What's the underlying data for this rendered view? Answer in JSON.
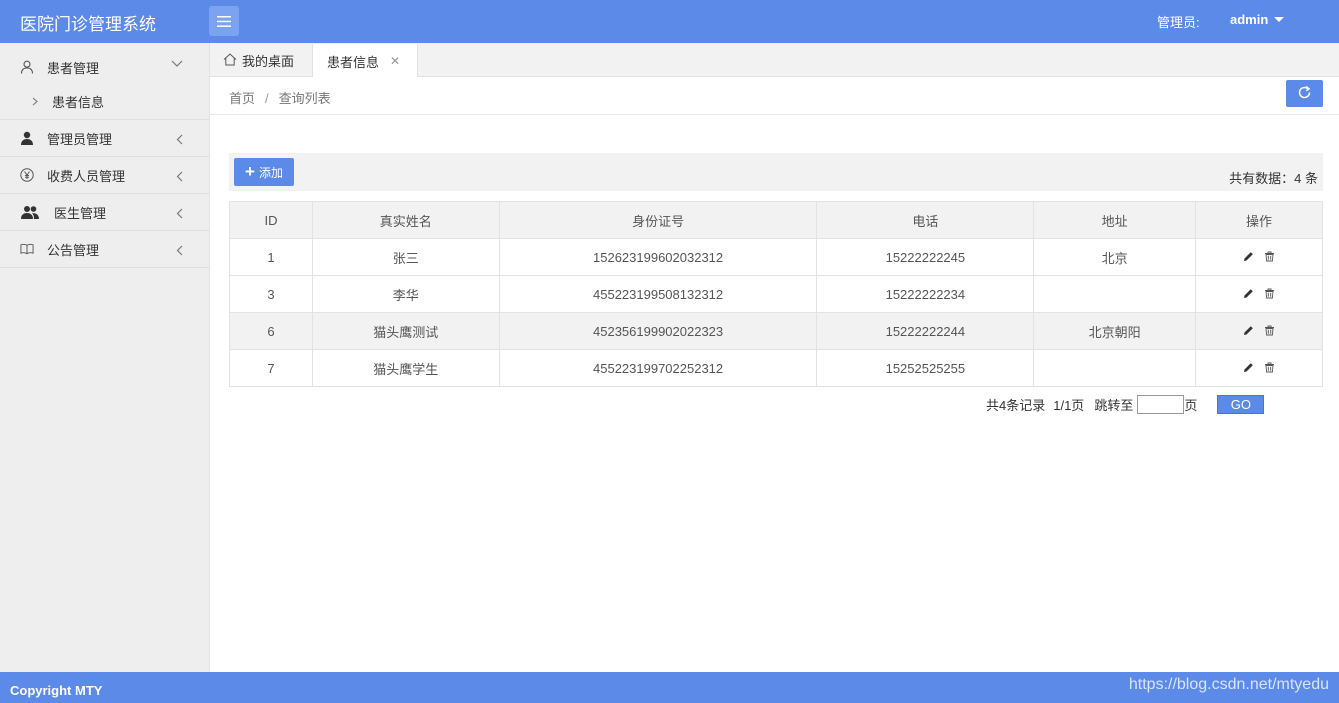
{
  "header": {
    "title": "医院门诊管理系统",
    "admin_label": "管理员:",
    "admin_user": "admin"
  },
  "sidebar": {
    "items": [
      {
        "label": "患者管理",
        "icon": "user-outline-icon",
        "expanded": true
      },
      {
        "label": "管理员管理",
        "icon": "user-solid-icon"
      },
      {
        "label": "收费人员管理",
        "icon": "yen-icon"
      },
      {
        "label": "医生管理",
        "icon": "users-icon"
      },
      {
        "label": "公告管理",
        "icon": "book-icon"
      }
    ],
    "sub_item": "患者信息"
  },
  "tabs": {
    "home": "我的桌面",
    "active": "患者信息"
  },
  "breadcrumb": {
    "home": "首页",
    "separator": "/",
    "current": "查询列表"
  },
  "toolbar": {
    "add_label": "添加",
    "total_text": "共有数据：4 条"
  },
  "table": {
    "headers": [
      "ID",
      "真实姓名",
      "身份证号",
      "电话",
      "地址",
      "操作"
    ],
    "rows": [
      [
        "1",
        "张三",
        "152623199602032312",
        "15222222245",
        "北京"
      ],
      [
        "3",
        "李华",
        "455223199508132312",
        "15222222234",
        ""
      ],
      [
        "6",
        "猫头鹰测试",
        "452356199902022323",
        "15222222244",
        "北京朝阳"
      ],
      [
        "7",
        "猫头鹰学生",
        "455223199702252312",
        "15252525255",
        ""
      ]
    ]
  },
  "pager": {
    "records": "共4条记录",
    "pages": "1/1页",
    "jump_to": "跳转至",
    "page_unit": "页",
    "go": "GO"
  },
  "footer": {
    "copyright": "Copyright MTY",
    "watermark": "https://blog.csdn.net/mtyedu"
  },
  "colors": {
    "primary": "#5b8ae8",
    "sidebar_bg": "#eeeeee"
  }
}
